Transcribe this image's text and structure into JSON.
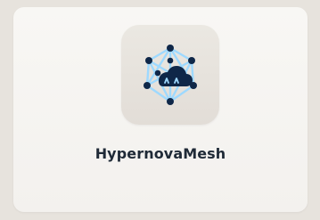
{
  "app": {
    "name": "HypernovaMesh",
    "icon": "cloud-network-icon"
  },
  "colors": {
    "background": "#e7e3dd",
    "card": "#f5f3f0",
    "tile": "#e6e2dc",
    "icon_dark": "#0f2748",
    "icon_light": "#9ed9ff",
    "text": "#1f2a37"
  }
}
